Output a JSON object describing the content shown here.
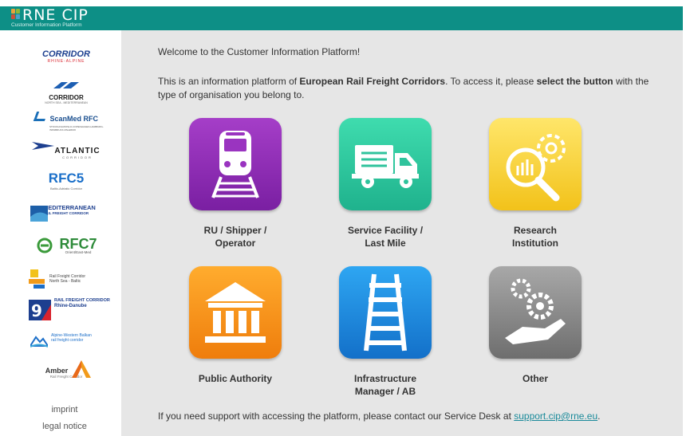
{
  "header": {
    "logo_text": "RNE CIP",
    "logo_subtitle": "Customer Information Platform",
    "bar_color": "#0d8f86"
  },
  "sidebar": {
    "corridors": [
      {
        "name": "CORRIDOR",
        "sub": "RHINE-ALPINE"
      },
      {
        "name": "CORRIDOR",
        "sub": "NORTH SEA - MEDITERRANEAN"
      },
      {
        "name": "ScanMed RFC",
        "sub": "STOCKHOLM/OSLO-COPENHAGEN-HAMBURG-INNSBRUCK-PALERMO"
      },
      {
        "name": "ATLANTIC",
        "sub": "CORRIDOR"
      },
      {
        "name": "RFC5",
        "sub": "Baltic-Adriatic Corridor"
      },
      {
        "name": "MEDITERRANEAN",
        "sub": "RAIL FREIGHT CORRIDOR"
      },
      {
        "name": "RFC7",
        "sub": "Orient/East-Med"
      },
      {
        "name": "Rail Freight Corridor",
        "sub": "North Sea - Baltic"
      },
      {
        "name": "RAIL FREIGHT CORRIDOR",
        "sub": "Rhine-Danube"
      },
      {
        "name": "Alpine-Western Balkan",
        "sub": "rail freight corridor"
      },
      {
        "name": "Amber",
        "sub": "Rail Freight Corridor"
      }
    ],
    "imprint_label": "imprint",
    "legal_label": "legal notice"
  },
  "main": {
    "welcome": "Welcome to the Customer Information Platform!",
    "intro_part1": "This is an information platform of ",
    "intro_bold1": "European Rail Freight Corridors",
    "intro_part2": ". To access it, please ",
    "intro_bold2": "select the button",
    "intro_part3": " with the type of organisation you belong to.",
    "tiles": [
      {
        "line1": "RU / Shipper /",
        "line2": "Operator",
        "icon": "train-icon",
        "color_top": "#a53ec8",
        "color_bottom": "#7a1fa2"
      },
      {
        "line1": "Service Facility /",
        "line2": "Last Mile",
        "icon": "truck-icon",
        "color_top": "#36d3a6",
        "color_bottom": "#1fb28d"
      },
      {
        "line1": "Research",
        "line2": "Institution",
        "icon": "research-icon",
        "color_top": "#ffe45a",
        "color_bottom": "#f2c21a"
      },
      {
        "line1": "Public Authority",
        "line2": "",
        "icon": "building-icon",
        "color_top": "#ffa726",
        "color_bottom": "#ef7d0c"
      },
      {
        "line1": "Infrastructure",
        "line2": "Manager / AB",
        "icon": "rail-track-icon",
        "color_top": "#2a9ef0",
        "color_bottom": "#1370c9"
      },
      {
        "line1": "Other",
        "line2": "",
        "icon": "gears-hand-icon",
        "color_top": "#a3a3a3",
        "color_bottom": "#6e6e6e"
      }
    ],
    "support_text": "If you need support with accessing the platform, please contact our Service Desk at ",
    "support_link": "support.cip@rne.eu",
    "support_end": "."
  }
}
